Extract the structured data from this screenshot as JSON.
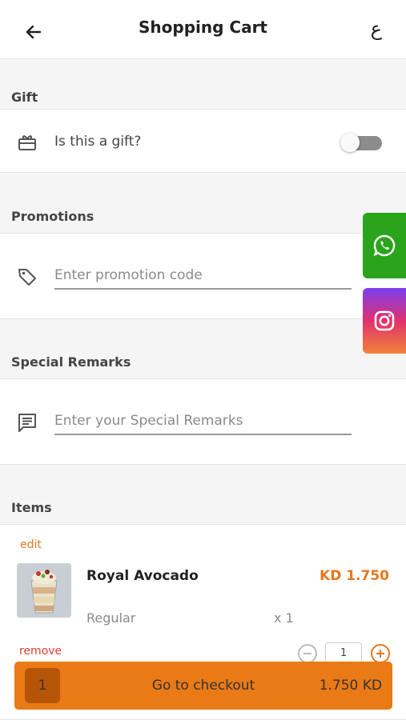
{
  "header": {
    "title": "Shopping Cart",
    "back_icon": "arrow-left-icon",
    "language_toggle": "ع"
  },
  "gift": {
    "section_title": "Gift",
    "icon": "gift-icon",
    "label": "Is this a gift?",
    "toggle_on": false
  },
  "promotions": {
    "section_title": "Promotions",
    "icon": "tag-icon",
    "placeholder": "Enter promotion code",
    "value": ""
  },
  "remarks": {
    "section_title": "Special Remarks",
    "icon": "message-icon",
    "placeholder": "Enter your Special Remarks",
    "value": ""
  },
  "social": {
    "whatsapp_icon": "whatsapp-icon",
    "instagram_icon": "instagram-icon",
    "whatsapp_color": "#2aa41a"
  },
  "items": {
    "section_title": "Items",
    "list": [
      {
        "edit_label": "edit",
        "name": "Royal Avocado",
        "price": "KD 1.750",
        "variant": "Regular",
        "quantity_text": "x 1",
        "remove_label": "remove",
        "quantity": "1"
      }
    ]
  },
  "checkout": {
    "count": "1",
    "label": "Go to checkout",
    "total": "1.750 KD"
  },
  "colors": {
    "accent": "#ea7a15",
    "price": "#e8771d",
    "remove": "#e23b2e"
  }
}
